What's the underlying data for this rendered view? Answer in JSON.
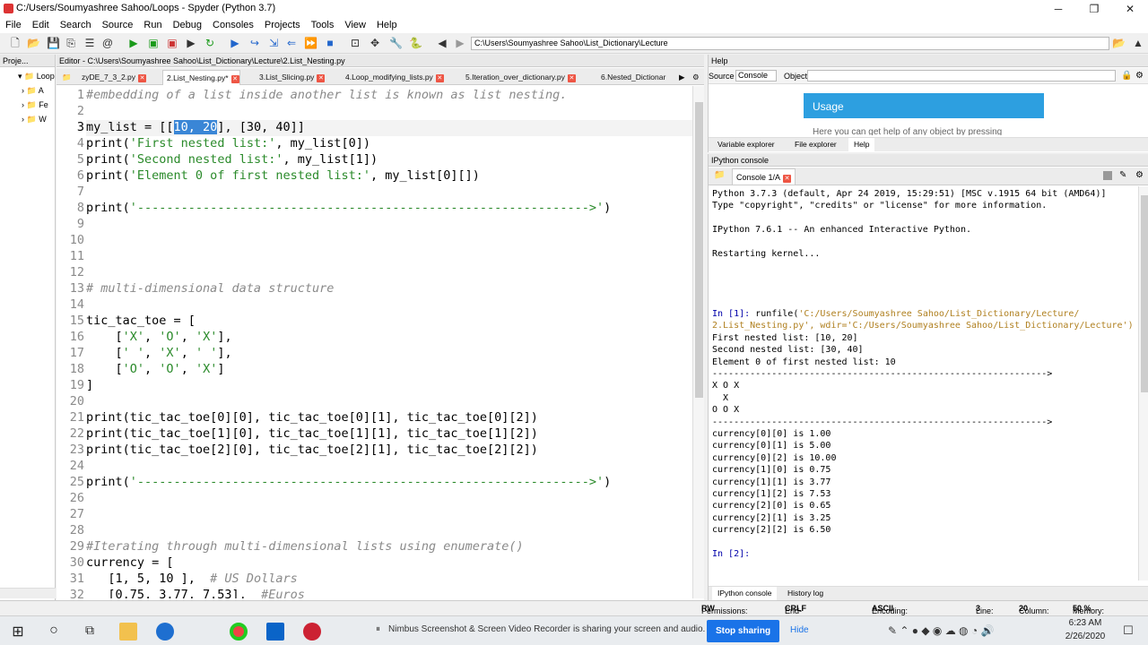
{
  "window": {
    "title": "C:/Users/Soumyashree Sahoo/Loops - Spyder (Python 3.7)",
    "min": "─",
    "max": "❐",
    "close": "✕"
  },
  "menu": [
    "File",
    "Edit",
    "Search",
    "Source",
    "Run",
    "Debug",
    "Consoles",
    "Projects",
    "Tools",
    "View",
    "Help"
  ],
  "toolbar": {
    "path": "C:\\Users\\Soumyashree Sahoo\\List_Dictionary\\Lecture"
  },
  "project": {
    "header": "Proje...",
    "root": "Loop",
    "items": [
      "A",
      "Fe",
      "W"
    ]
  },
  "editor": {
    "header": "Editor - C:\\Users\\Soumyashree Sahoo\\List_Dictionary\\Lecture\\2.List_Nesting.py",
    "tabs": [
      "zyDE_7_3_2.py",
      "2.List_Nesting.py*",
      "3.List_Slicing.py",
      "4.Loop_modifying_lists.py",
      "5.Iteration_over_dictionary.py",
      "6.Nested_Dictionar"
    ],
    "active_tab": 1,
    "lines": [
      "#embedding of a list inside another list is known as list nesting.",
      "",
      "my_list = [[10, 20], [30, 40]]",
      "print('First nested list:', my_list[0])",
      "print('Second nested list:', my_list[1])",
      "print('Element 0 of first nested list:', my_list[0][])",
      "",
      "print('-------------------------------------------------------------->')",
      "",
      "",
      "",
      "",
      "# multi-dimensional data structure",
      "",
      "tic_tac_toe = [",
      "    ['X', 'O', 'X'],",
      "    [' ', 'X', ' '],",
      "    ['O', 'O', 'X']",
      "]",
      "",
      "print(tic_tac_toe[0][0], tic_tac_toe[0][1], tic_tac_toe[0][2])",
      "print(tic_tac_toe[1][0], tic_tac_toe[1][1], tic_tac_toe[1][2])",
      "print(tic_tac_toe[2][0], tic_tac_toe[2][1], tic_tac_toe[2][2])",
      "",
      "print('-------------------------------------------------------------->')",
      "",
      "",
      "",
      "#Iterating through multi-dimensional lists using enumerate()",
      "currency = [",
      "   [1, 5, 10 ],  # US Dollars",
      "   [0.75, 3.77, 7.53],  #Euros"
    ],
    "line_numbers": [
      "1",
      "2",
      "3",
      "4",
      "5",
      "6",
      "7",
      "8",
      "9",
      "10",
      "11",
      "12",
      "13",
      "14",
      "15",
      "16",
      "17",
      "18",
      "19",
      "20",
      "21",
      "22",
      "23",
      "24",
      "25",
      "26",
      "27",
      "28",
      "29",
      "30",
      "31",
      "32"
    ],
    "current_line": 3,
    "selected_text": "10, 20"
  },
  "help": {
    "header": "Help",
    "source_label": "Source",
    "source_value": "Console",
    "object_label": "Object",
    "usage_title": "Usage",
    "usage_text": "Here you can get help of any object by pressing",
    "tabs": [
      "Variable explorer",
      "File explorer",
      "Help"
    ]
  },
  "ipython": {
    "header": "IPython console",
    "tab": "Console 1/A",
    "lines": [
      "Python 3.7.3 (default, Apr 24 2019, 15:29:51) [MSC v.1915 64 bit (AMD64)]",
      "Type \"copyright\", \"credits\" or \"license\" for more information.",
      "",
      "IPython 7.6.1 -- An enhanced Interactive Python.",
      "",
      "Restarting kernel...",
      "",
      "",
      "",
      "",
      "In [1]: runfile('C:/Users/Soumyashree Sahoo/List_Dictionary/Lecture/",
      "2.List_Nesting.py', wdir='C:/Users/Soumyashree Sahoo/List_Dictionary/Lecture')",
      "First nested list: [10, 20]",
      "Second nested list: [30, 40]",
      "Element 0 of first nested list: 10",
      "-------------------------------------------------------------->",
      "X O X",
      "  X",
      "O O X",
      "-------------------------------------------------------------->",
      "currency[0][0] is 1.00",
      "currency[0][1] is 5.00",
      "currency[0][2] is 10.00",
      "currency[1][0] is 0.75",
      "currency[1][1] is 3.77",
      "currency[1][2] is 7.53",
      "currency[2][0] is 0.65",
      "currency[2][1] is 3.25",
      "currency[2][2] is 6.50",
      "",
      "In [2]:"
    ],
    "bottom_tabs": [
      "IPython console",
      "History log"
    ]
  },
  "status": {
    "permissions_label": "Permissions:",
    "permissions": "RW",
    "eol_label": "End-of-lines:",
    "eol": "CRLF",
    "encoding_label": "Encoding:",
    "encoding": "ASCII",
    "line_label": "Line:",
    "line": "3",
    "column_label": "Column:",
    "column": "20",
    "memory_label": "Memory:",
    "memory": "50 %"
  },
  "taskbar": {
    "share_message": "Nimbus Screenshot & Screen Video Recorder is sharing your screen and audio.",
    "stop_sharing": "Stop sharing",
    "hide": "Hide",
    "time": "6:23 AM",
    "date": "2/26/2020"
  },
  "colors": {
    "selection": "#3a86d6",
    "usage_blue": "#2d9fe0",
    "stop_sharing": "#1a73e8"
  }
}
